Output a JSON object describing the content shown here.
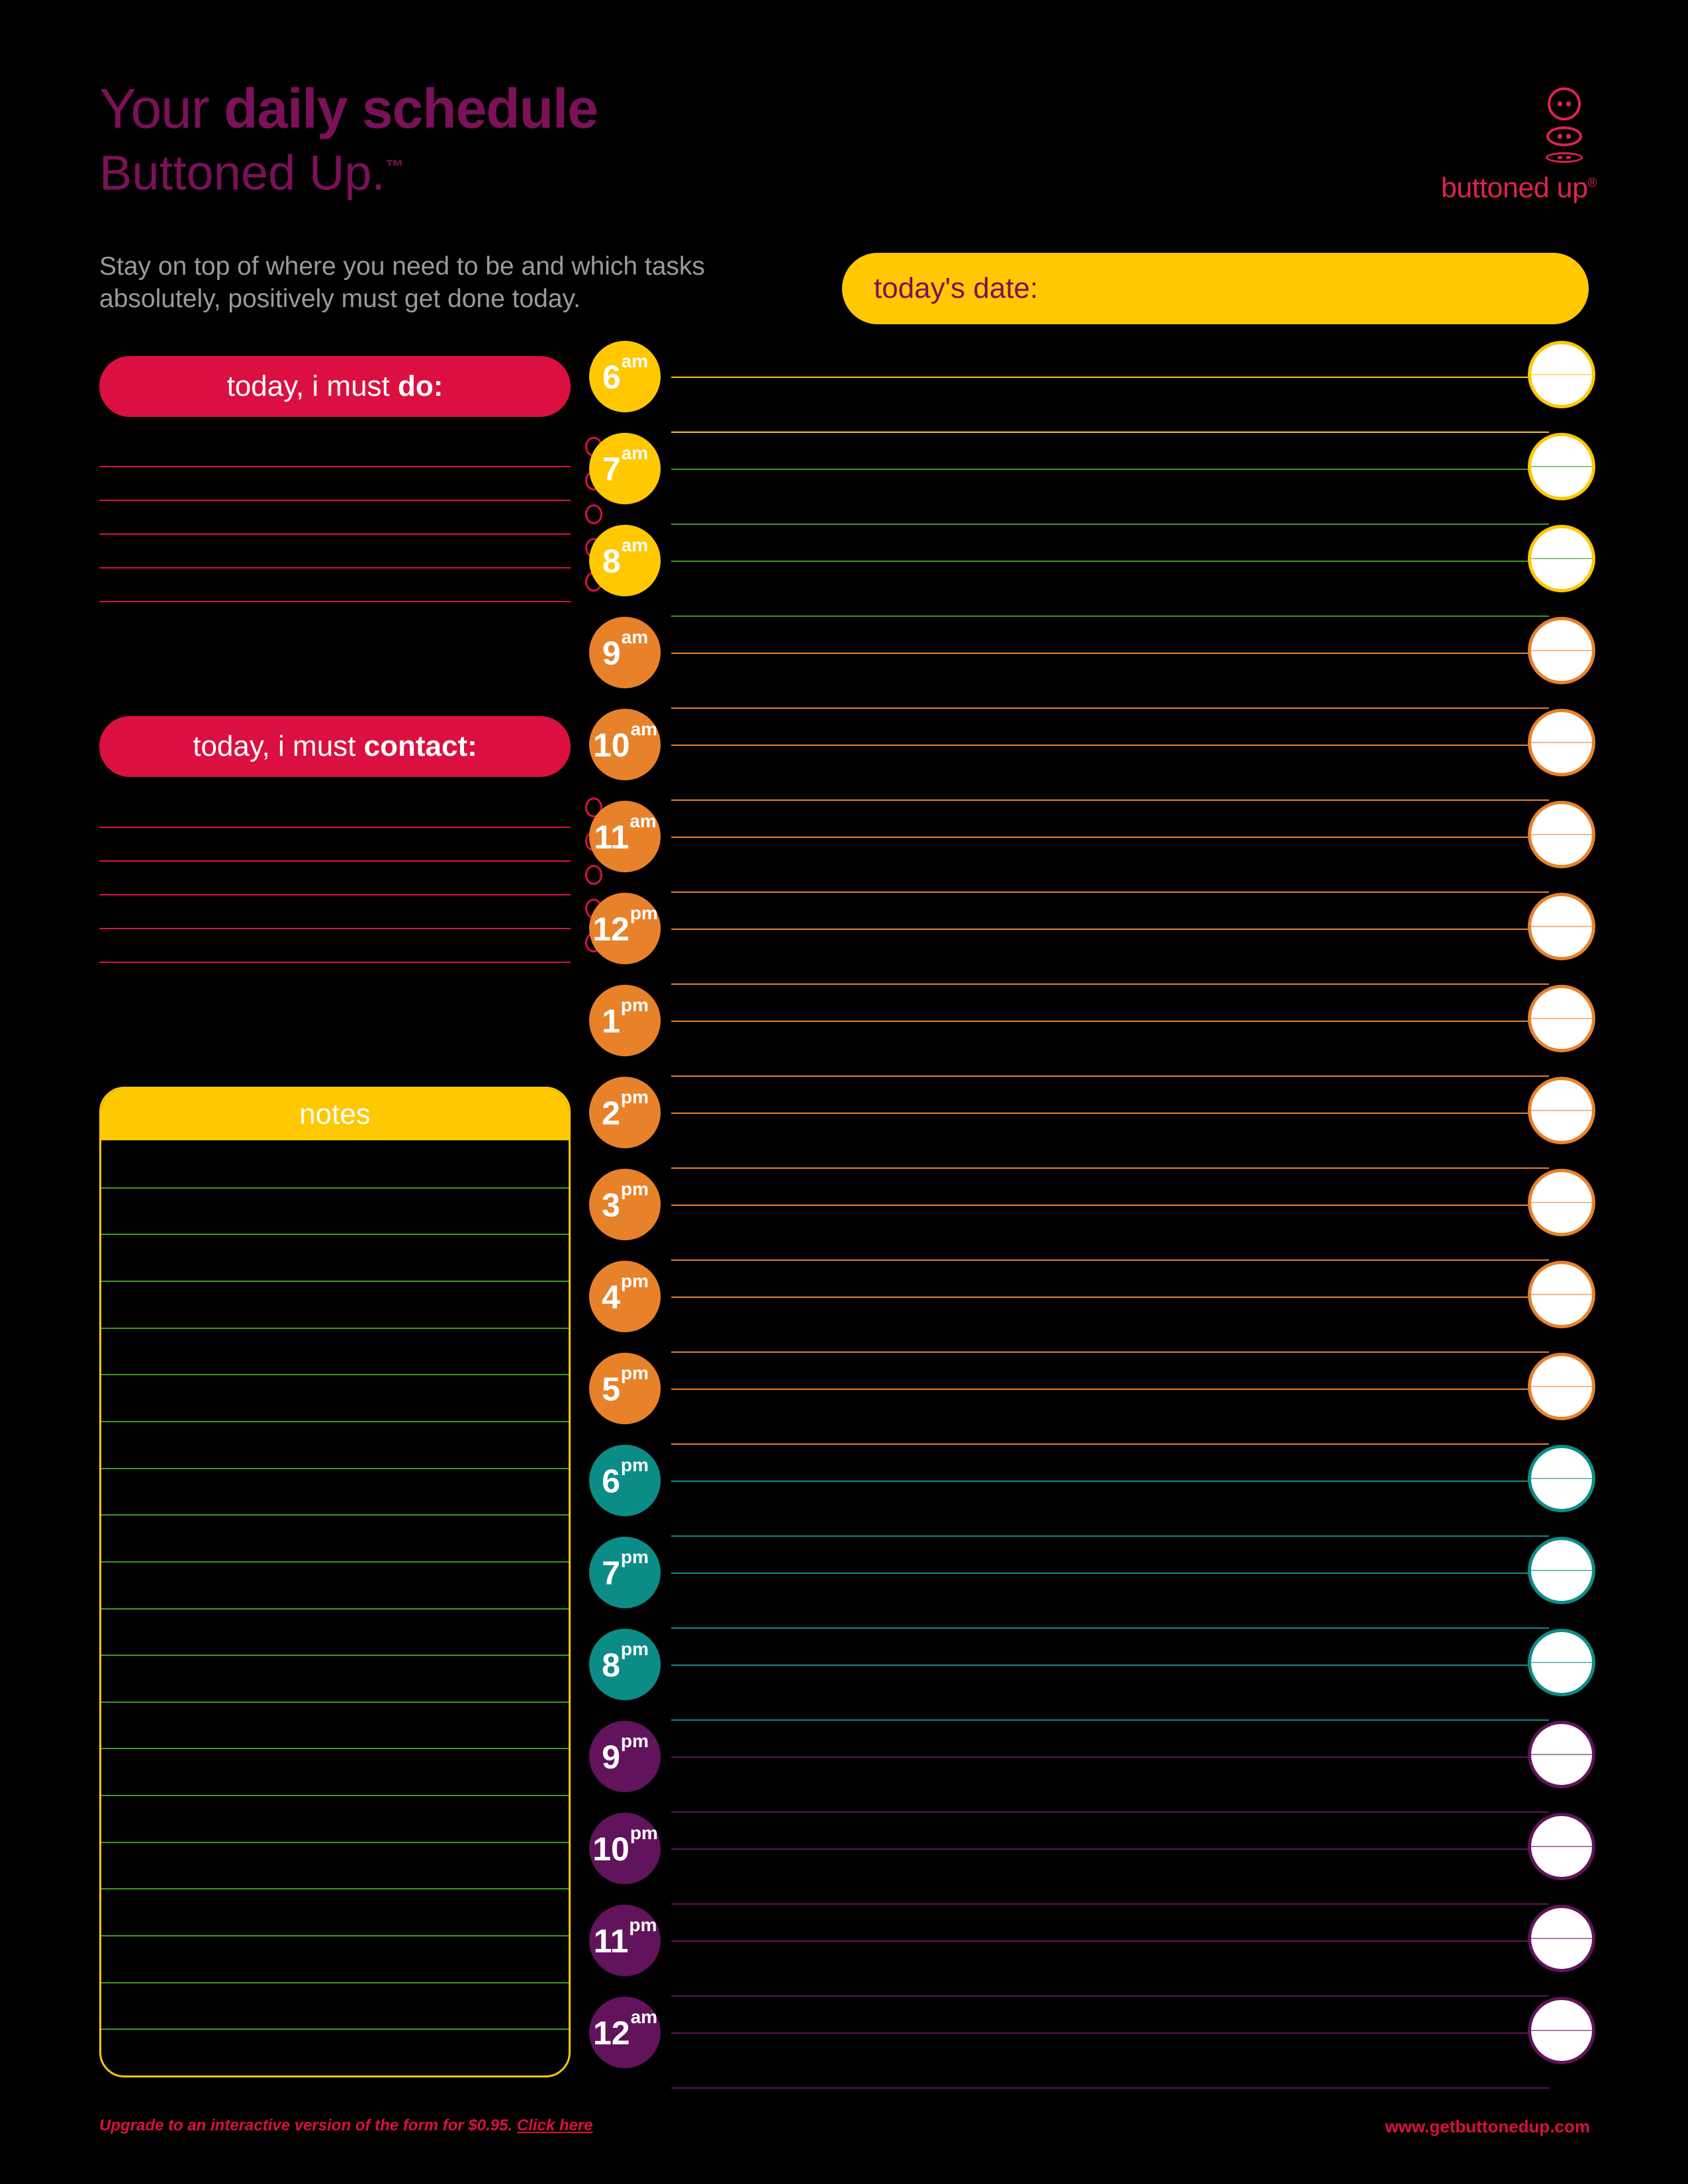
{
  "header": {
    "title_light": "Your ",
    "title_bold": "daily schedule",
    "brand": "Buttoned Up.",
    "brand_tm": "™",
    "subtitle": "Stay on top of where you need to be and which tasks absolutely, positively must get done today."
  },
  "logo": {
    "text": "buttoned up",
    "registered": "®",
    "icon_round": "button-round-icon",
    "icon_oval": "button-oval-icon",
    "icon_flat": "button-flat-icon"
  },
  "date_field": {
    "label": "today's date:",
    "value": "",
    "placeholder": "",
    "bg": "#FFC800",
    "text_color": "#7B1158"
  },
  "do_section": {
    "label_light": "today, i must ",
    "label_bold": "do:",
    "line_count": 5,
    "color": "#DB1040"
  },
  "contact_section": {
    "label_light": "today, i must ",
    "label_bold": "contact:",
    "line_count": 5,
    "color": "#DB1040"
  },
  "notes_section": {
    "label": "notes",
    "line_count": 19,
    "border_color": "#FFC800",
    "rule_color": "#3D9B20"
  },
  "colors": {
    "background": "#000000",
    "purple": "#7B1158",
    "crimson": "#DB1040",
    "logo_red": "#E0224E",
    "yellow": "#FFC800",
    "orange": "#E8822A",
    "teal": "#0C8C87",
    "deep_purple": "#61135B",
    "grey_text": "#9A9A9A",
    "green_rule": "#3D9B20"
  },
  "schedule": {
    "slots": [
      {
        "hour": "6",
        "meridiem": "am",
        "bubble": "#FFC800",
        "rule_top": "#FFC800",
        "rule_bot": "#FFC800"
      },
      {
        "hour": "7",
        "meridiem": "am",
        "bubble": "#FFC800",
        "rule_top": "#3D9B20",
        "rule_bot": "#3D9B20"
      },
      {
        "hour": "8",
        "meridiem": "am",
        "bubble": "#FFC800",
        "rule_top": "#3D9B20",
        "rule_bot": "#3D9B20"
      },
      {
        "hour": "9",
        "meridiem": "am",
        "bubble": "#E8822A",
        "rule_top": "#E8822A",
        "rule_bot": "#E8822A"
      },
      {
        "hour": "10",
        "meridiem": "am",
        "bubble": "#E8822A",
        "rule_top": "#E8822A",
        "rule_bot": "#E8822A"
      },
      {
        "hour": "11",
        "meridiem": "am",
        "bubble": "#E8822A",
        "rule_top": "#E8822A",
        "rule_bot": "#E8822A"
      },
      {
        "hour": "12",
        "meridiem": "pm",
        "bubble": "#E8822A",
        "rule_top": "#E8822A",
        "rule_bot": "#E8822A"
      },
      {
        "hour": "1",
        "meridiem": "pm",
        "bubble": "#E8822A",
        "rule_top": "#E8822A",
        "rule_bot": "#E8822A"
      },
      {
        "hour": "2",
        "meridiem": "pm",
        "bubble": "#E8822A",
        "rule_top": "#E8822A",
        "rule_bot": "#E8822A"
      },
      {
        "hour": "3",
        "meridiem": "pm",
        "bubble": "#E8822A",
        "rule_top": "#E8822A",
        "rule_bot": "#E8822A"
      },
      {
        "hour": "4",
        "meridiem": "pm",
        "bubble": "#E8822A",
        "rule_top": "#E8822A",
        "rule_bot": "#E8822A"
      },
      {
        "hour": "5",
        "meridiem": "pm",
        "bubble": "#E8822A",
        "rule_top": "#E8822A",
        "rule_bot": "#E8822A"
      },
      {
        "hour": "6",
        "meridiem": "pm",
        "bubble": "#0C8C87",
        "rule_top": "#0C8C87",
        "rule_bot": "#0C8C87"
      },
      {
        "hour": "7",
        "meridiem": "pm",
        "bubble": "#0C8C87",
        "rule_top": "#0C8C87",
        "rule_bot": "#0C8C87"
      },
      {
        "hour": "8",
        "meridiem": "pm",
        "bubble": "#0C8C87",
        "rule_top": "#0C8C87",
        "rule_bot": "#0C8C87"
      },
      {
        "hour": "9",
        "meridiem": "pm",
        "bubble": "#61135B",
        "rule_top": "#61135B",
        "rule_bot": "#61135B"
      },
      {
        "hour": "10",
        "meridiem": "pm",
        "bubble": "#61135B",
        "rule_top": "#61135B",
        "rule_bot": "#61135B"
      },
      {
        "hour": "11",
        "meridiem": "pm",
        "bubble": "#61135B",
        "rule_top": "#61135B",
        "rule_bot": "#61135B"
      },
      {
        "hour": "12",
        "meridiem": "am",
        "bubble": "#61135B",
        "rule_top": "#61135B",
        "rule_bot": "#61135B"
      }
    ]
  },
  "footer": {
    "upgrade_text": "Upgrade to an interactive version of the form for $0.95. ",
    "upgrade_link": "Click here",
    "website": "www.getbuttonedup.com"
  }
}
